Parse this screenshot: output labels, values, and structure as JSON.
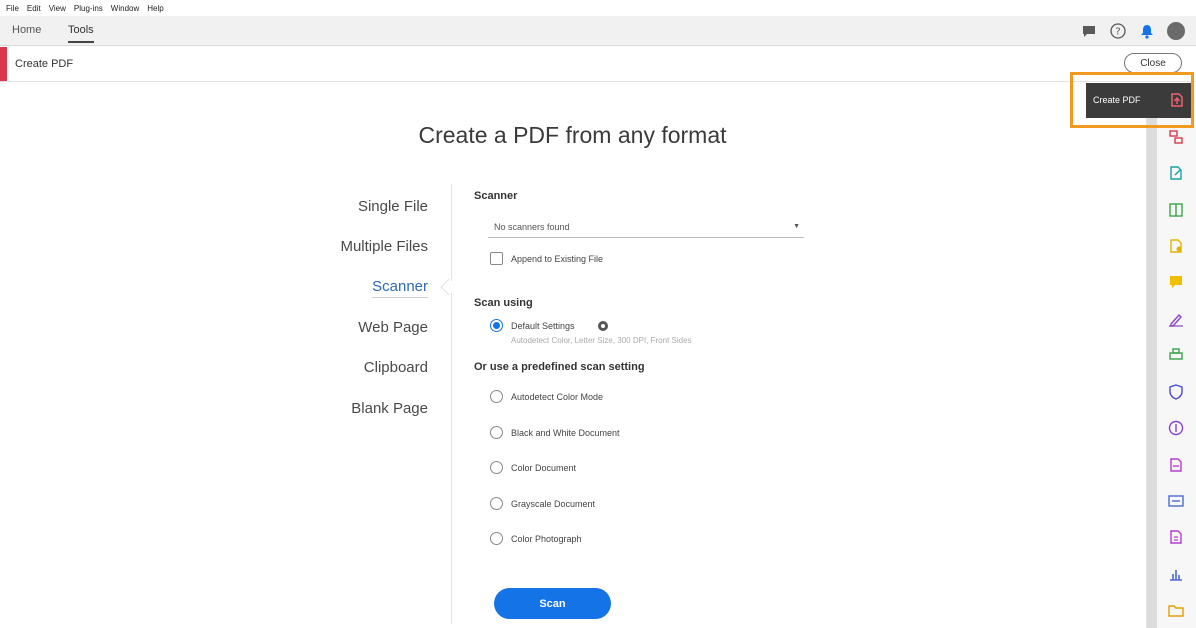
{
  "menu": [
    "File",
    "Edit",
    "View",
    "Plug-ins",
    "Window",
    "Help"
  ],
  "tabs": {
    "home": "Home",
    "tools": "Tools"
  },
  "tool_header": {
    "title": "Create PDF",
    "close_label": "Close"
  },
  "heading": "Create a PDF from any format",
  "left_nav": [
    "Single File",
    "Multiple Files",
    "Scanner",
    "Web Page",
    "Clipboard",
    "Blank Page"
  ],
  "left_nav_active": "Scanner",
  "scanner": {
    "section_label": "Scanner",
    "dropdown_value": "No scanners found",
    "append_label": "Append to Existing File",
    "append_checked": false,
    "scan_using_label": "Scan using",
    "default_settings_label": "Default Settings",
    "default_settings_desc": "Autodetect Color, Letter Size, 300 DPI, Front Sides",
    "predefined_label": "Or use a predefined scan setting",
    "options": [
      "Autodetect Color Mode",
      "Black and White Document",
      "Color Document",
      "Grayscale Document",
      "Color Photograph"
    ],
    "scan_button": "Scan"
  },
  "tooltip": {
    "label": "Create PDF"
  },
  "colors": {
    "accent_blue": "#1473e6",
    "create_pdf_red": "#d9394a",
    "highlight_orange": "#f29a1f"
  },
  "right_rail_icons": [
    "combine-files-icon",
    "edit-pdf-icon",
    "export-pdf-icon",
    "organize-pages-icon",
    "comment-icon",
    "fill-sign-icon",
    "print-production-icon",
    "protect-icon",
    "redact-icon",
    "send-for-comments-icon",
    "prepare-form-icon",
    "compare-icon",
    "measure-icon",
    "folder-icon"
  ]
}
